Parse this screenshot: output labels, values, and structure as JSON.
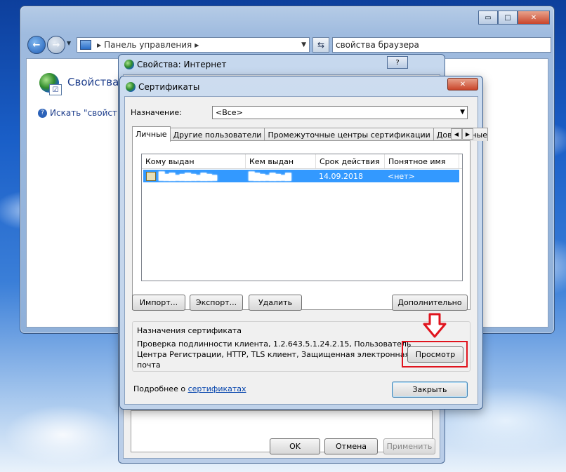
{
  "explorer": {
    "address_text": "Панель управления",
    "search_value": "свойства браузера",
    "page_title": "Свойства",
    "help_link": "Искать \"свойства"
  },
  "window_controls": {
    "minimize": "▭",
    "maximize": "□",
    "close": "✕"
  },
  "internet_properties": {
    "title": "Свойства: Интернет",
    "help": "?",
    "buttons": {
      "ok": "OK",
      "cancel": "Отмена",
      "apply": "Применить"
    }
  },
  "certificates": {
    "title": "Сертификаты",
    "close": "✕",
    "purpose_label": "Назначение:",
    "purpose_value": "<Все>",
    "tabs": [
      {
        "label": "Личные"
      },
      {
        "label": "Другие пользователи"
      },
      {
        "label": "Промежуточные центры сертификации"
      },
      {
        "label": "Доверенные"
      }
    ],
    "columns": [
      "Кому выдан",
      "Кем выдан",
      "Срок действия",
      "Понятное имя"
    ],
    "rows": [
      {
        "issued_to": "█▆▇▅▆▇▆▅▇▆▅",
        "issued_by": "█▇▆▅▇▆▅▇",
        "expires": "14.09.2018",
        "friendly": "<нет>"
      }
    ],
    "buttons": {
      "import": "Импорт...",
      "export": "Экспорт...",
      "remove": "Удалить",
      "advanced": "Дополнительно",
      "view": "Просмотр",
      "close": "Закрыть"
    },
    "purposes_title": "Назначения сертификата",
    "purposes_line1": "Проверка подлинности клиента, 1.2.643.5.1.24.2.15, Пользователь",
    "purposes_line2": "Центра Регистрации, HTTP, TLS клиент, Защищенная электронная почта",
    "more_prefix": "Подробнее о ",
    "more_link": "сертификатах"
  }
}
